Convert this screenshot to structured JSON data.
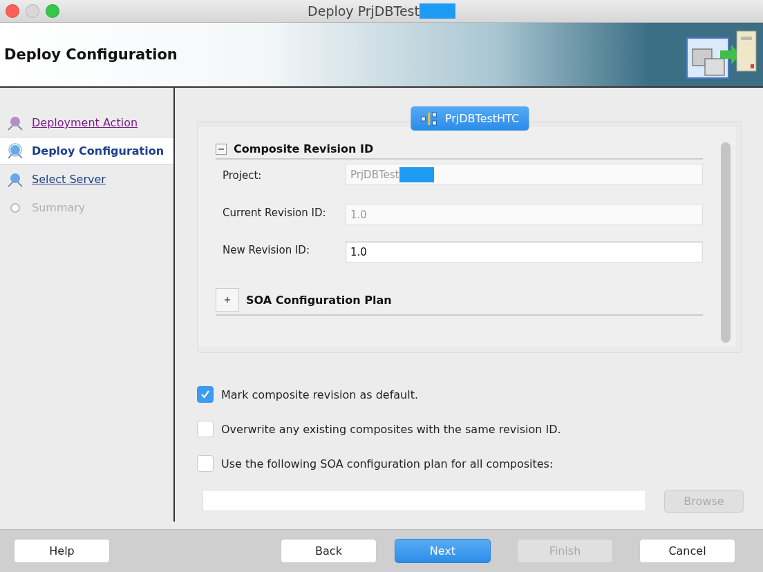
{
  "window": {
    "title": "Deploy PrjDBTest",
    "title_redacted": true
  },
  "header": {
    "title": "Deploy Configuration"
  },
  "steps": [
    {
      "label": "Deployment Action",
      "kind": "visited",
      "selected": false
    },
    {
      "label": "Deploy Configuration",
      "kind": "current",
      "selected": true
    },
    {
      "label": "Select Server",
      "kind": "link",
      "selected": false
    },
    {
      "label": "Summary",
      "kind": "disabled",
      "selected": false
    }
  ],
  "composite_tab": {
    "label": "PrjDBTestHTC"
  },
  "sections": [
    {
      "title": "Composite Revision ID",
      "expanded": true,
      "fields": [
        {
          "label": "Project:",
          "value": "PrjDBTest",
          "disabled": true,
          "redacted": true
        },
        {
          "label": "Current Revision ID:",
          "value": "1.0",
          "disabled": true,
          "redacted": false
        },
        {
          "label": "New Revision ID:",
          "value": "1.0",
          "disabled": false,
          "redacted": false
        }
      ]
    },
    {
      "title": "SOA Configuration Plan",
      "expanded": false
    }
  ],
  "options": [
    {
      "label": "Mark composite revision as default.",
      "checked": true
    },
    {
      "label": "Overwrite any existing composites with the same revision ID.",
      "checked": false
    },
    {
      "label": "Use the following SOA configuration plan for all composites:",
      "checked": false
    }
  ],
  "plan_path": {
    "browse": {
      "label": "Browse",
      "disabled": true
    }
  },
  "buttons": [
    {
      "label": "Help",
      "kind": "normal",
      "disabled": false
    },
    {
      "label": "Back",
      "kind": "normal",
      "disabled": false
    },
    {
      "label": "Next",
      "kind": "primary",
      "disabled": false
    },
    {
      "label": "Finish",
      "kind": "normal",
      "disabled": true
    },
    {
      "label": "Cancel",
      "kind": "normal",
      "disabled": false
    }
  ]
}
